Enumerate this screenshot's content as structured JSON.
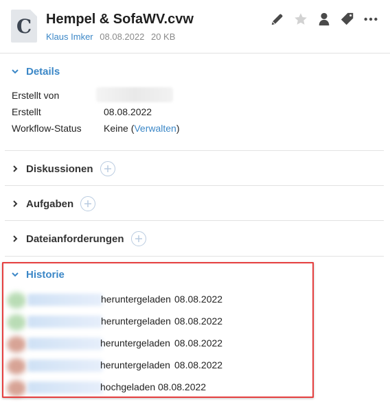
{
  "file": {
    "icon_letter": "C",
    "title": "Hempel & SofaWV.cvw",
    "owner": "Klaus Imker",
    "date": "08.08.2022",
    "size": "20 KB"
  },
  "actions": [
    "pencil-icon",
    "star-icon",
    "person-icon",
    "tag-icon",
    "more-icon"
  ],
  "details": {
    "title": "Details",
    "created_by_label": "Erstellt von",
    "created_label": "Erstellt",
    "created_value": "08.08.2022",
    "workflow_label": "Workflow-Status",
    "workflow_value": "Keine (",
    "workflow_link": "Verwalten",
    "workflow_close": ")"
  },
  "sections": {
    "discussions": "Diskussionen",
    "tasks": "Aufgaben",
    "requests": "Dateianforderungen"
  },
  "history": {
    "title": "Historie",
    "entries": [
      {
        "action": "heruntergeladen",
        "date": "08.08.2022",
        "avatar_color": "#b9dcb5"
      },
      {
        "action": "heruntergeladen",
        "date": "08.08.2022",
        "avatar_color": "#b9dcb5"
      },
      {
        "action": "heruntergeladen",
        "date": "08.08.2022",
        "avatar_color": "#d7a395"
      },
      {
        "action": "heruntergeladen",
        "date": "08.08.2022",
        "avatar_color": "#d7a395"
      },
      {
        "action": "hochgeladen",
        "date": "08.08.2022",
        "avatar_color": "#d7a395"
      }
    ]
  },
  "colors": {
    "accent": "#3b87c7",
    "highlight_border": "#e53e3e"
  }
}
